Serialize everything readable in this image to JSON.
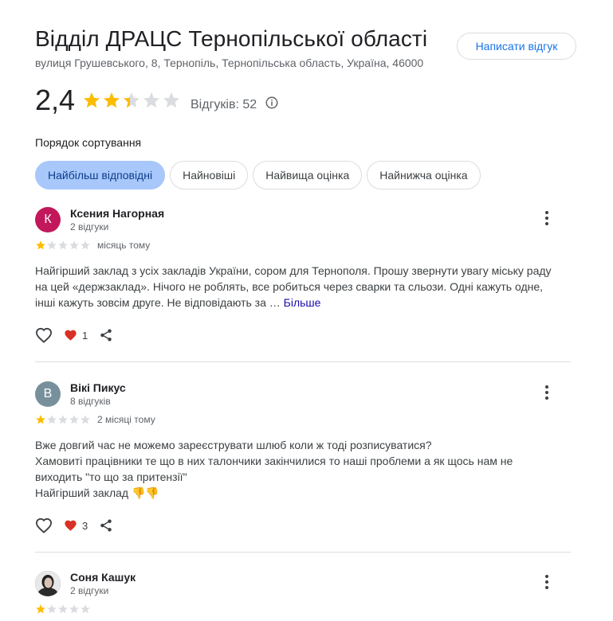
{
  "header": {
    "title": "Відділ ДРАЦС Тернопільської області",
    "address": "вулиця Грушевського, 8, Тернопіль, Тернопільська область, Україна, 46000",
    "write_review_label": "Написати відгук"
  },
  "rating": {
    "value": "2,4",
    "stars": 2.4,
    "reviews_label": "Відгуків: 52",
    "info_icon": "info-icon"
  },
  "sort": {
    "label": "Порядок сортування",
    "options": [
      "Найбільш відповідні",
      "Найновіші",
      "Найвища оцінка",
      "Найнижча оцінка"
    ],
    "active_index": 0
  },
  "reviews": [
    {
      "author": "Ксения Нагорная",
      "meta": "2 відгуки",
      "avatar_letter": "К",
      "avatar_color": "#c2185b",
      "stars": 1,
      "time": "місяць тому",
      "lines": [
        "Найгірший заклад з усіх закладів України, сором для Тернополя. Прошу звернути увагу міську раду",
        "на цей «держзаклад». Нічого не роблять, все робиться через сварки та сльози. Одні кажуть одне,",
        "інші кажуть зовсім друге. Не відповідають за …"
      ],
      "more_label": "Більше",
      "likes": "1"
    },
    {
      "author": "Вікі Пикус",
      "meta": "8 відгуків",
      "avatar_letter": "В",
      "avatar_color": "#78909c",
      "stars": 1,
      "time": "2 місяці тому",
      "lines": [
        "Вже довгий час не можемо зареєструвати шлюб коли ж тоді розписуватися?",
        "Хамовиті працівники те що в них талончики закінчилися то наші проблеми а як щось нам не",
        "виходить \"то що за притензії\"",
        "Найгірший заклад 👎👎"
      ],
      "likes": "3"
    },
    {
      "author": "Соня Кашук",
      "meta": "2 відгуки",
      "avatar_letter": "",
      "avatar_color": "#4a4a4a",
      "stars": 1
    }
  ],
  "colors": {
    "star_filled": "#fbbc04",
    "star_empty": "#dadce0",
    "accent": "#1a73e8",
    "active_chip": "#a8c7fa",
    "heart": "#d93025"
  },
  "icons": [
    "star-icon",
    "heart-outline-icon",
    "heart-filled-icon",
    "share-icon",
    "more-vert-icon",
    "info-icon"
  ]
}
